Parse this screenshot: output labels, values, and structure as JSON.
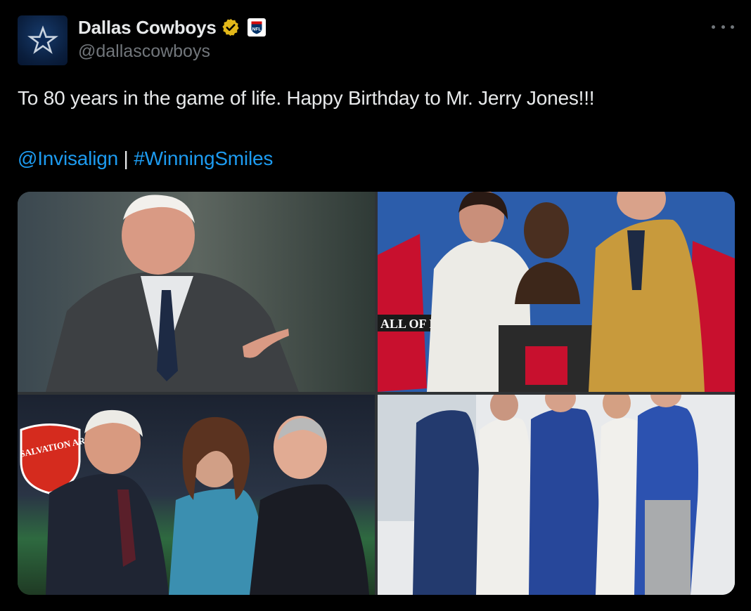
{
  "account": {
    "display_name": "Dallas Cowboys",
    "handle": "@dallascowboys",
    "verified_icon": "verified-gold-badge",
    "affiliate_badge": "nfl-logo",
    "avatar_icon": "star-icon"
  },
  "tweet": {
    "text_line1": "To 80 years in the game of life. Happy Birthday to Mr. Jerry Jones!!!",
    "mention": "@Invisalign",
    "separator": " | ",
    "hashtag": "#WinningSmiles"
  },
  "media": {
    "photos": [
      {
        "id": "photo-1"
      },
      {
        "id": "photo-2",
        "sign_text": "ALL OF FAM"
      },
      {
        "id": "photo-3",
        "sign_text": "THE SALVATION ARMY"
      },
      {
        "id": "photo-4"
      }
    ]
  },
  "colors": {
    "background": "#000000",
    "text": "#e7e9ea",
    "secondary_text": "#71767b",
    "link": "#1d9bf0",
    "verified_gold": "#e2b719"
  },
  "icons": {
    "more": "more-horizontal-icon"
  }
}
